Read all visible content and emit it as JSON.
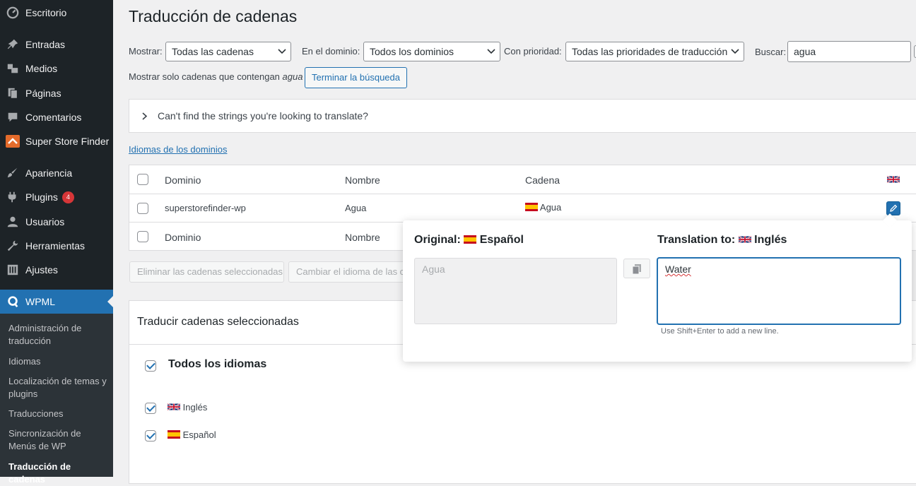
{
  "sidebar": {
    "items": [
      {
        "label": "Escritorio",
        "icon": "dashboard-icon"
      },
      {
        "label": "Entradas",
        "icon": "pin-icon"
      },
      {
        "label": "Medios",
        "icon": "media-icon"
      },
      {
        "label": "Páginas",
        "icon": "page-icon"
      },
      {
        "label": "Comentarios",
        "icon": "comment-icon"
      },
      {
        "label": "Super Store Finder",
        "icon": "store-finder-icon"
      },
      {
        "label": "Apariencia",
        "icon": "brush-icon"
      },
      {
        "label": "Plugins",
        "icon": "plugin-icon",
        "badge": "4"
      },
      {
        "label": "Usuarios",
        "icon": "user-icon"
      },
      {
        "label": "Herramientas",
        "icon": "wrench-icon"
      },
      {
        "label": "Ajustes",
        "icon": "settings-icon"
      },
      {
        "label": "WPML",
        "icon": "wpml-icon"
      }
    ],
    "submenu": [
      "Administración de traducción",
      "Idiomas",
      "Localización de temas y plugins",
      "Traducciones",
      "Sincronización de Menús de WP",
      "Traducción de cadenas"
    ]
  },
  "page": {
    "title": "Traducción de cadenas"
  },
  "filters": {
    "show_label": "Mostrar:",
    "show_value": "Todas las cadenas",
    "domain_label": "En el dominio:",
    "domain_value": "Todos los dominios",
    "priority_label": "Con prioridad:",
    "priority_value": "Todas las prioridades de traducción",
    "search_label": "Buscar:",
    "search_value": "agua",
    "only_text": "Mostrar solo cadenas que contengan",
    "only_term": "agua",
    "end_search_button": "Terminar la búsqueda"
  },
  "help_box": {
    "text": "Can't find the strings you're looking to translate?"
  },
  "domain_languages_link": "Idiomas de los dominios",
  "table": {
    "headers": {
      "domain": "Dominio",
      "name": "Nombre",
      "string": "Cadena"
    },
    "rows": [
      {
        "domain": "superstorefinder-wp",
        "name": "Agua",
        "string": "Agua"
      }
    ],
    "footer": {
      "domain": "Dominio",
      "name": "Nombre"
    }
  },
  "actions": {
    "delete_button": "Eliminar las cadenas seleccionadas",
    "change_lang_button": "Cambiar el idioma de las cadenas seleccionadas"
  },
  "translate_box": {
    "title": "Traducir cadenas seleccionadas",
    "all_languages": "Todos los idiomas",
    "languages": [
      "Inglés",
      "Español"
    ]
  },
  "popup": {
    "original_label": "Original:",
    "original_lang": "Español",
    "original_text": "Agua",
    "translation_label": "Translation to:",
    "translation_lang": "Inglés",
    "translation_text": "Water",
    "hint": "Use Shift+Enter to add a new line."
  },
  "colors": {
    "sidebar": "#1d2327",
    "accent": "#2271b1",
    "badge": "#d63638"
  }
}
